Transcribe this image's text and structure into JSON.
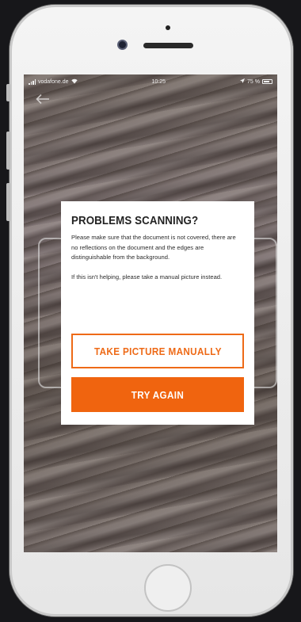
{
  "status_bar": {
    "carrier": "vodafone.de",
    "time": "10:25",
    "battery": "75 %"
  },
  "dialog": {
    "title": "PROBLEMS SCANNING?",
    "message": "Please make sure that the document is not covered, there are no reflections on the document and the edges are distinguishable from the background.",
    "hint": "If this isn't helping, please take a manual picture instead.",
    "manual_button_label": "TAKE PICTURE MANUALLY",
    "retry_button_label": "TRY AGAIN"
  },
  "icons": {
    "back": "back-arrow-icon",
    "signal": "signal-icon",
    "wifi": "wifi-icon",
    "location": "location-icon",
    "battery": "battery-icon"
  },
  "colors": {
    "accent": "#f0640f",
    "dialog_background": "#ffffff",
    "title_text": "#232323"
  }
}
